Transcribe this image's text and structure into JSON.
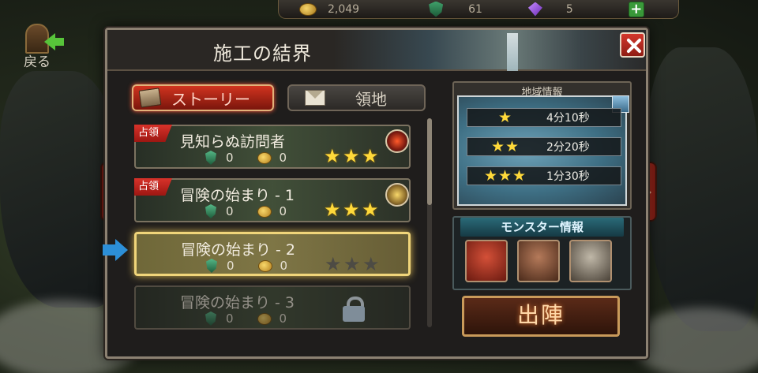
{
  "resources": {
    "gold": "2,049",
    "shield": "61",
    "gem": "5"
  },
  "back": {
    "label": "戻る"
  },
  "panel": {
    "title": "施工の結界"
  },
  "tabs": [
    {
      "label": "ストーリー",
      "active": true
    },
    {
      "label": "領地",
      "active": false
    }
  ],
  "stages": [
    {
      "name": "見知らぬ訪問者",
      "badge": "占領",
      "shield": "0",
      "coin": "0",
      "stars": 3,
      "state": "cleared"
    },
    {
      "name": "冒険の始まり - 1",
      "badge": "占領",
      "shield": "0",
      "coin": "0",
      "stars": 3,
      "state": "cleared"
    },
    {
      "name": "冒険の始まり - 2",
      "badge": "",
      "shield": "0",
      "coin": "0",
      "stars": 0,
      "state": "selected"
    },
    {
      "name": "冒険の始まり - 3",
      "badge": "",
      "shield": "0",
      "coin": "0",
      "stars": 0,
      "state": "locked"
    }
  ],
  "region": {
    "title": "地域情報",
    "times": [
      {
        "stars": "★",
        "time": "4分10秒"
      },
      {
        "stars": "★★",
        "time": "2分20秒"
      },
      {
        "stars": "★★★",
        "time": "1分30秒"
      }
    ]
  },
  "monster": {
    "title": "モンスター情報"
  },
  "sortie": {
    "label": "出陣"
  },
  "colors": {
    "accent_red": "#c03524",
    "star_gold": "#ffd93a",
    "selected_border": "#f0d57a"
  }
}
